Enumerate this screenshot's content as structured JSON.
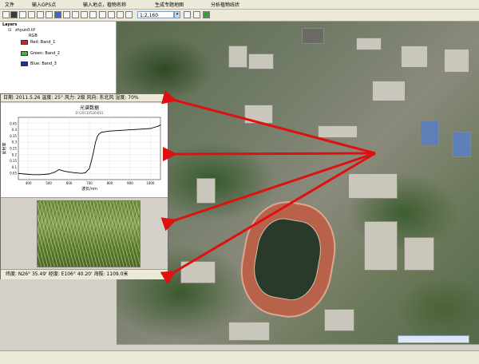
{
  "menu": {
    "file": "文件",
    "input_gps": "输入GPS点",
    "input_place": "输入地点，植物名称",
    "gen_map": "生成专题地图",
    "analyze": "分析植物线状"
  },
  "toolbar": {
    "scale": "1:2,160"
  },
  "toc": {
    "layers": "Layers",
    "file": "zhyun0.tif",
    "rgb": "RGB",
    "red": "Red:   Band_1",
    "green": "Green:   Band_2",
    "blue": "Blue:   Band_3",
    "red_color": "#e02020",
    "green_color": "#30c030",
    "blue_color": "#1030c0"
  },
  "info": {
    "top": "日期: 2011.5.26   温度: 25°   风力: 2级   风向: 东北风   湿度: 70%",
    "bottom": "纬度: N26° 35.49'   经度: E106° 40.20'   海拔: 1109.0米"
  },
  "arrow_color": "#e01010",
  "chart_data": {
    "type": "line",
    "title": "光谱数据",
    "subtitle": "D:\\20110526\\001",
    "xlabel": "波长/nm",
    "ylabel": "反射率",
    "xlim": [
      350,
      1050
    ],
    "ylim": [
      0,
      0.5
    ],
    "xticks": [
      "400",
      "500",
      "600",
      "700",
      "800",
      "900",
      "1000"
    ],
    "yticks": [
      "0.05",
      "0.1",
      "0.15",
      "0.2",
      "0.25",
      "0.3",
      "0.35",
      "0.4",
      "0.45"
    ],
    "x": [
      350,
      380,
      420,
      460,
      500,
      530,
      550,
      570,
      600,
      630,
      660,
      680,
      700,
      710,
      720,
      730,
      740,
      750,
      760,
      780,
      800,
      850,
      900,
      950,
      1000,
      1020,
      1040,
      1050
    ],
    "y": [
      0.05,
      0.045,
      0.04,
      0.04,
      0.045,
      0.06,
      0.08,
      0.07,
      0.06,
      0.055,
      0.05,
      0.055,
      0.09,
      0.15,
      0.22,
      0.3,
      0.35,
      0.37,
      0.38,
      0.385,
      0.39,
      0.395,
      0.4,
      0.405,
      0.41,
      0.42,
      0.43,
      0.44
    ]
  }
}
